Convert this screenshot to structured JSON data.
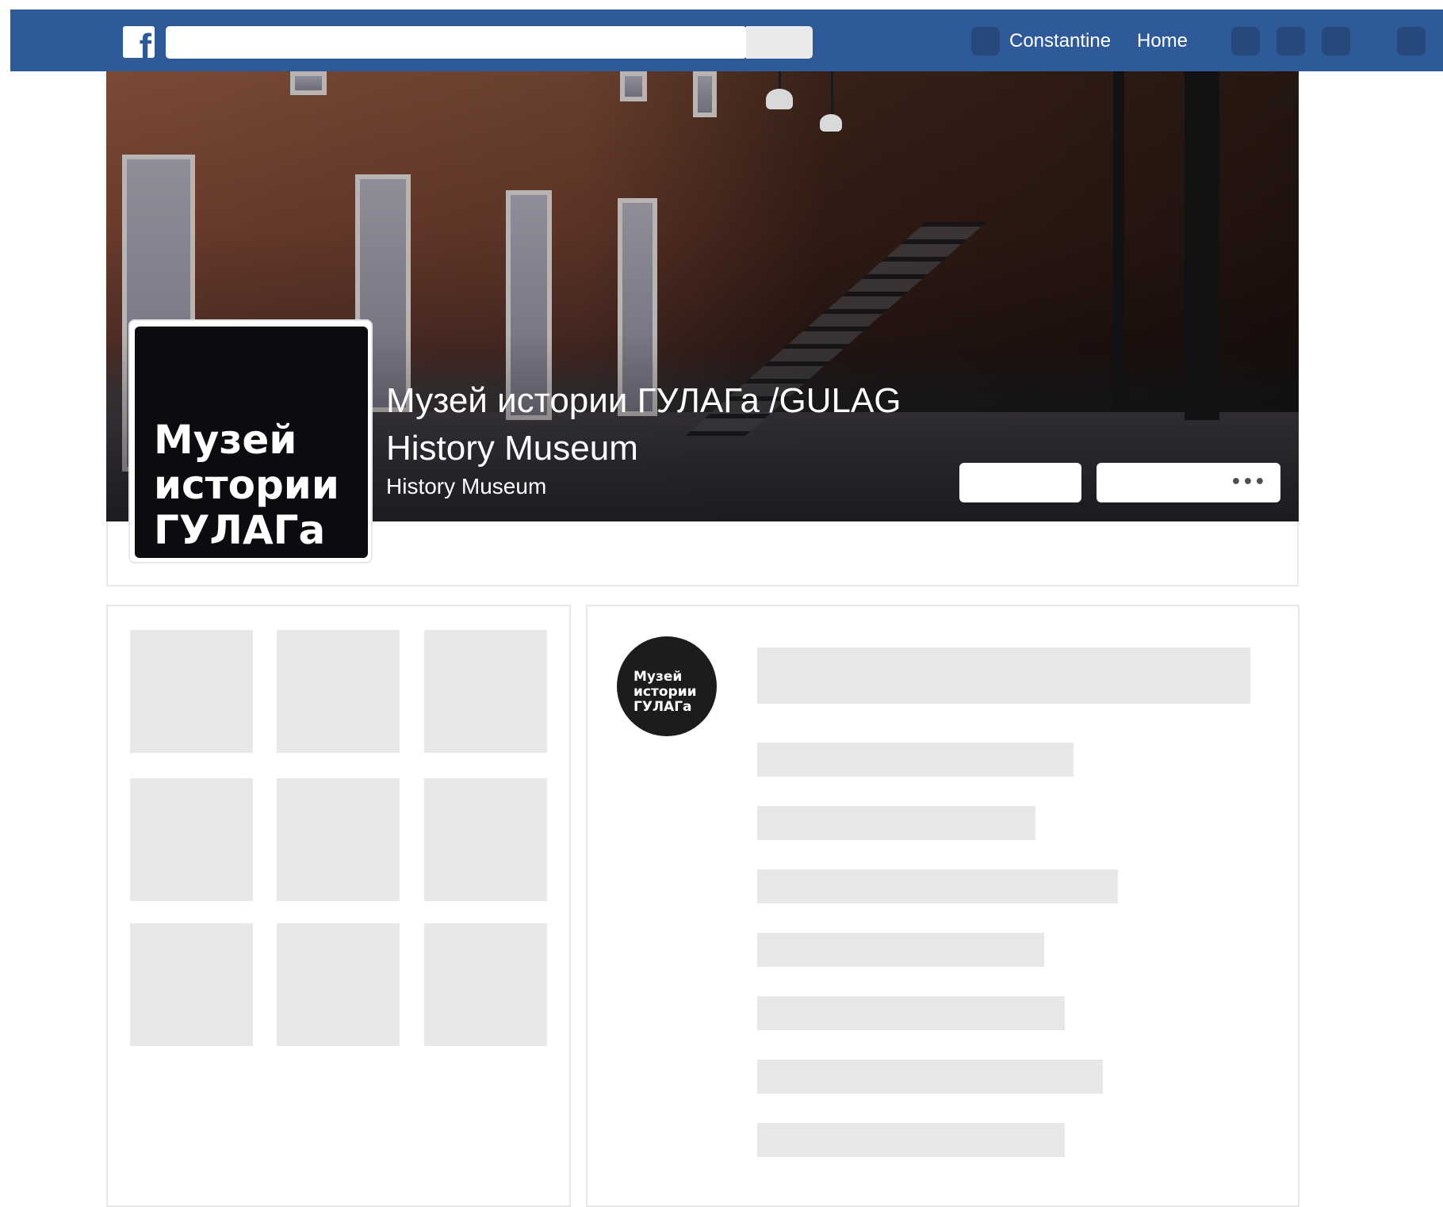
{
  "topbar": {
    "logo": "f",
    "search_placeholder": "",
    "user_name": "Constantine",
    "home_label": "Home",
    "color": "#2f5a99"
  },
  "page": {
    "title": "Музей истории ГУЛАГа /GULAG History Museum",
    "category": "History Museum",
    "profile_text": "Музей истории ГУЛАГа",
    "more_label": "•••"
  },
  "post": {
    "avatar_text": "Музей истории ГУЛАГа"
  },
  "icons": [
    "avatar-icon",
    "friend-requests-icon",
    "messages-icon",
    "notifications-icon",
    "settings-menu-icon"
  ]
}
